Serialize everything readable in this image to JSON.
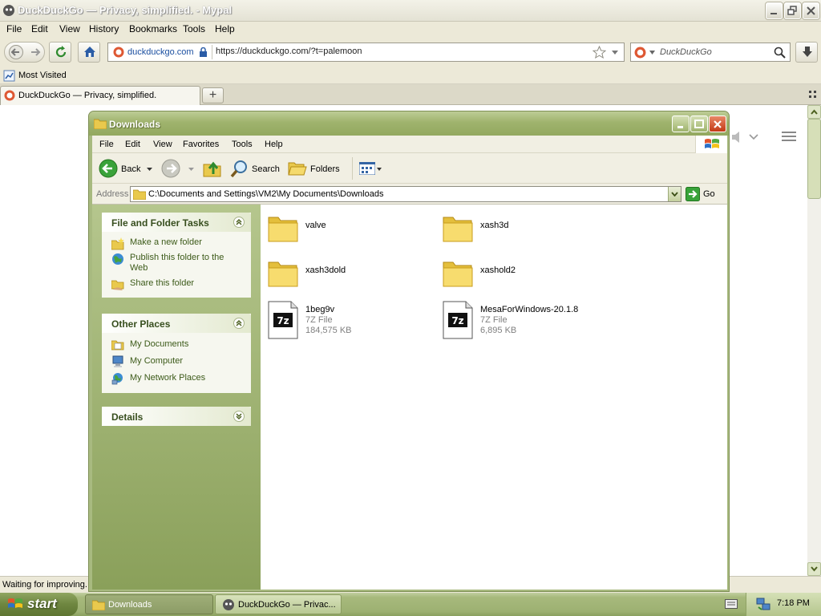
{
  "browser": {
    "title": "DuckDuckGo — Privacy, simplified. - Mypal",
    "menu": [
      "File",
      "Edit",
      "View",
      "History",
      "Bookmarks",
      "Tools",
      "Help"
    ],
    "site_identity": "duckduckgo.com",
    "url": "https://duckduckgo.com/?t=palemoon",
    "search_placeholder": "DuckDuckGo",
    "bookmark": "Most Visited",
    "tab_title": "DuckDuckGo — Privacy, simplified.",
    "new_tab": "+",
    "status": "Waiting for improving..."
  },
  "explorer": {
    "title": "Downloads",
    "menu": [
      "File",
      "Edit",
      "View",
      "Favorites",
      "Tools",
      "Help"
    ],
    "toolbar": {
      "back": "Back",
      "search": "Search",
      "folders": "Folders"
    },
    "address_label": "Address",
    "address": "C:\\Documents and Settings\\VM2\\My Documents\\Downloads",
    "go": "Go",
    "tasks": {
      "title": "File and Folder Tasks",
      "items": [
        "Make a new folder",
        "Publish this folder to the Web",
        "Share this folder"
      ]
    },
    "places": {
      "title": "Other Places",
      "items": [
        "My Documents",
        "My Computer",
        "My Network Places"
      ]
    },
    "details": {
      "title": "Details"
    },
    "files": [
      {
        "name": "valve",
        "type": "folder"
      },
      {
        "name": "xash3d",
        "type": "folder"
      },
      {
        "name": "xash3dold",
        "type": "folder"
      },
      {
        "name": "xashold2",
        "type": "folder"
      },
      {
        "name": "1beg9v",
        "type": "archive",
        "kind": "7Z File",
        "size": "184,575 KB"
      },
      {
        "name": "MesaForWindows-20.1.8",
        "type": "archive",
        "kind": "7Z File",
        "size": "6,895 KB"
      }
    ]
  },
  "taskbar": {
    "start": "start",
    "items": [
      "Downloads",
      "DuckDuckGo — Privac..."
    ],
    "clock": "7:18 PM"
  }
}
